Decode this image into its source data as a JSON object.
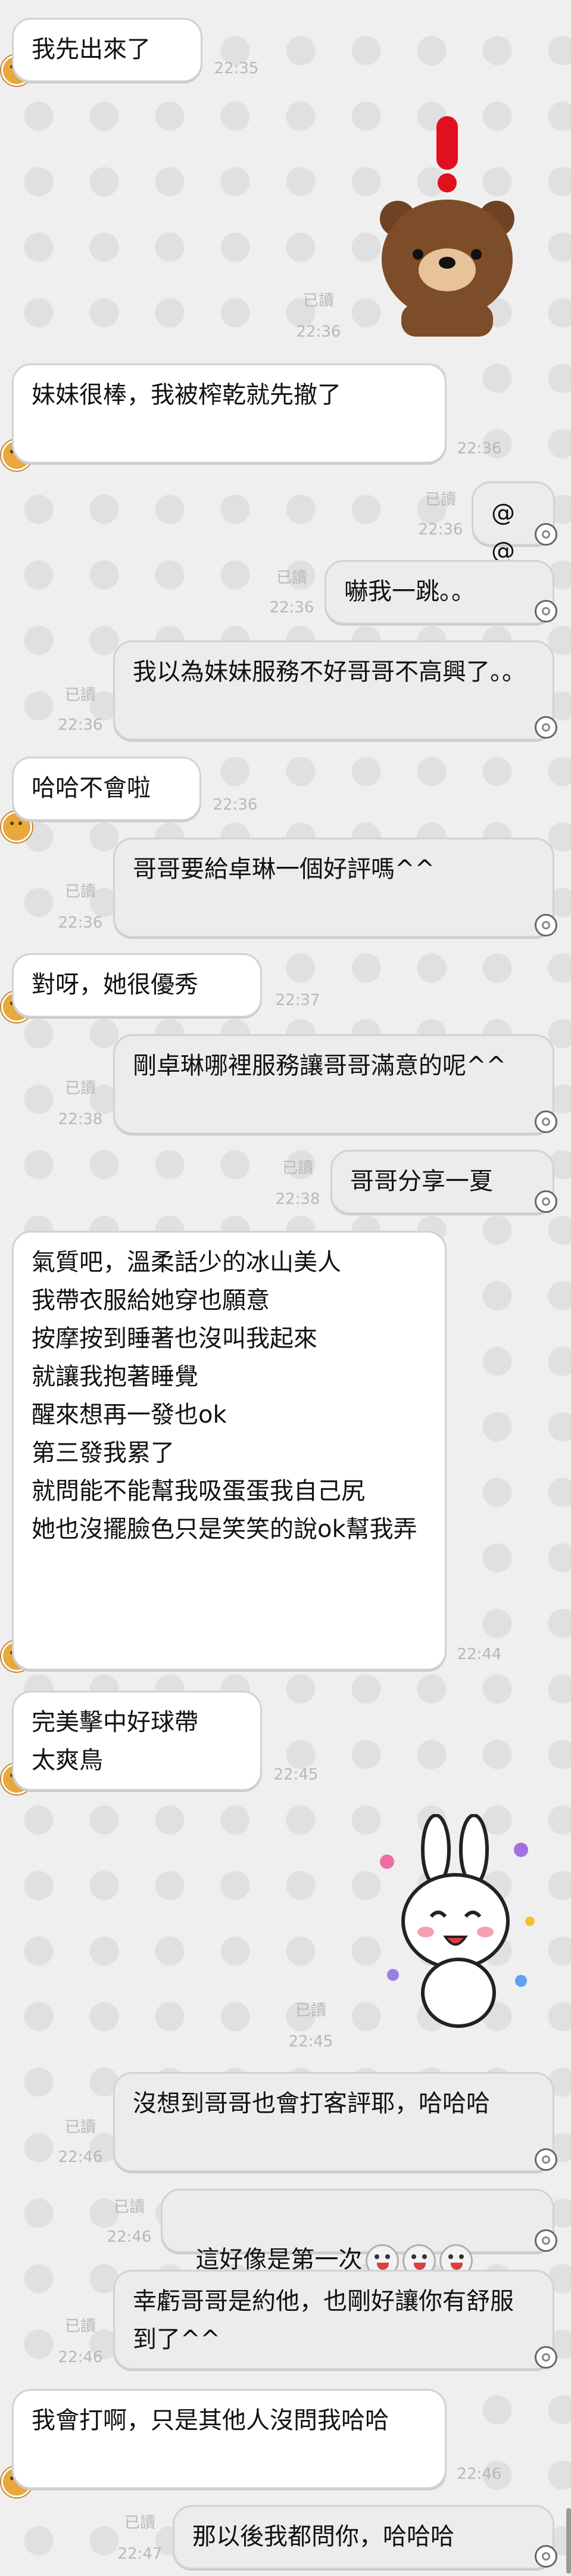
{
  "messages": [
    {
      "side": "left",
      "text": "我先出來了",
      "time": "22:35"
    },
    {
      "side": "right",
      "sticker": "brown-bear-exclamation-sticker",
      "read": "已讀",
      "time": "22:36"
    },
    {
      "side": "left",
      "text": "妹妹很棒，我被榨乾就先撤了",
      "time": "22:36"
    },
    {
      "side": "right",
      "text": "@@",
      "read": "已讀",
      "time": "22:36"
    },
    {
      "side": "right",
      "text": "嚇我一跳。。",
      "read": "已讀",
      "time": "22:36"
    },
    {
      "side": "right",
      "text": "我以為妹妹服務不好哥哥不高興了。。",
      "read": "已讀",
      "time": "22:36"
    },
    {
      "side": "left",
      "text": "哈哈不會啦",
      "time": "22:36"
    },
    {
      "side": "right",
      "text": "哥哥要給卓琳一個好評嗎^^",
      "read": "已讀",
      "time": "22:36"
    },
    {
      "side": "left",
      "text": "對呀，她很優秀",
      "time": "22:37"
    },
    {
      "side": "right",
      "text": "剛卓琳哪裡服務讓哥哥滿意的呢^^",
      "read": "已讀",
      "time": "22:38"
    },
    {
      "side": "right",
      "text": "哥哥分享一夏",
      "read": "已讀",
      "time": "22:38"
    },
    {
      "side": "left",
      "text": "氣質吧，溫柔話少的冰山美人\n我帶衣服給她穿也願意\n按摩按到睡著也沒叫我起來\n就讓我抱著睡覺\n醒來想再一發也ok\n第三發我累了\n就問能不能幫我吸蛋蛋我自己尻\n她也沒擺臉色只是笑笑的說ok幫我弄",
      "time": "22:44"
    },
    {
      "side": "left",
      "text": "完美擊中好球帶\n太爽鳥",
      "time": "22:45"
    },
    {
      "side": "right",
      "sticker": "cony-bunny-dancing-sticker",
      "read": "已讀",
      "time": "22:45"
    },
    {
      "side": "right",
      "text": "沒想到哥哥也會打客評耶，哈哈哈",
      "read": "已讀",
      "time": "22:46"
    },
    {
      "side": "right",
      "text": "這好像是第一次",
      "emoji_count": 3,
      "read": "已讀",
      "time": "22:46"
    },
    {
      "side": "right",
      "text": "幸虧哥哥是約他，也剛好讓你有舒服到了^^",
      "read": "已讀",
      "time": "22:46"
    },
    {
      "side": "left",
      "text": "我會打啊，只是其他人沒問我哈哈",
      "time": "22:46"
    },
    {
      "side": "right",
      "text": "那以後我都問你，哈哈哈",
      "read": "已讀",
      "time": "22:47"
    }
  ],
  "colors": {
    "background": "#efefef",
    "bubble_left": "#ffffff",
    "bubble_right": "#ececec",
    "meta_text": "#b8b8b8"
  }
}
